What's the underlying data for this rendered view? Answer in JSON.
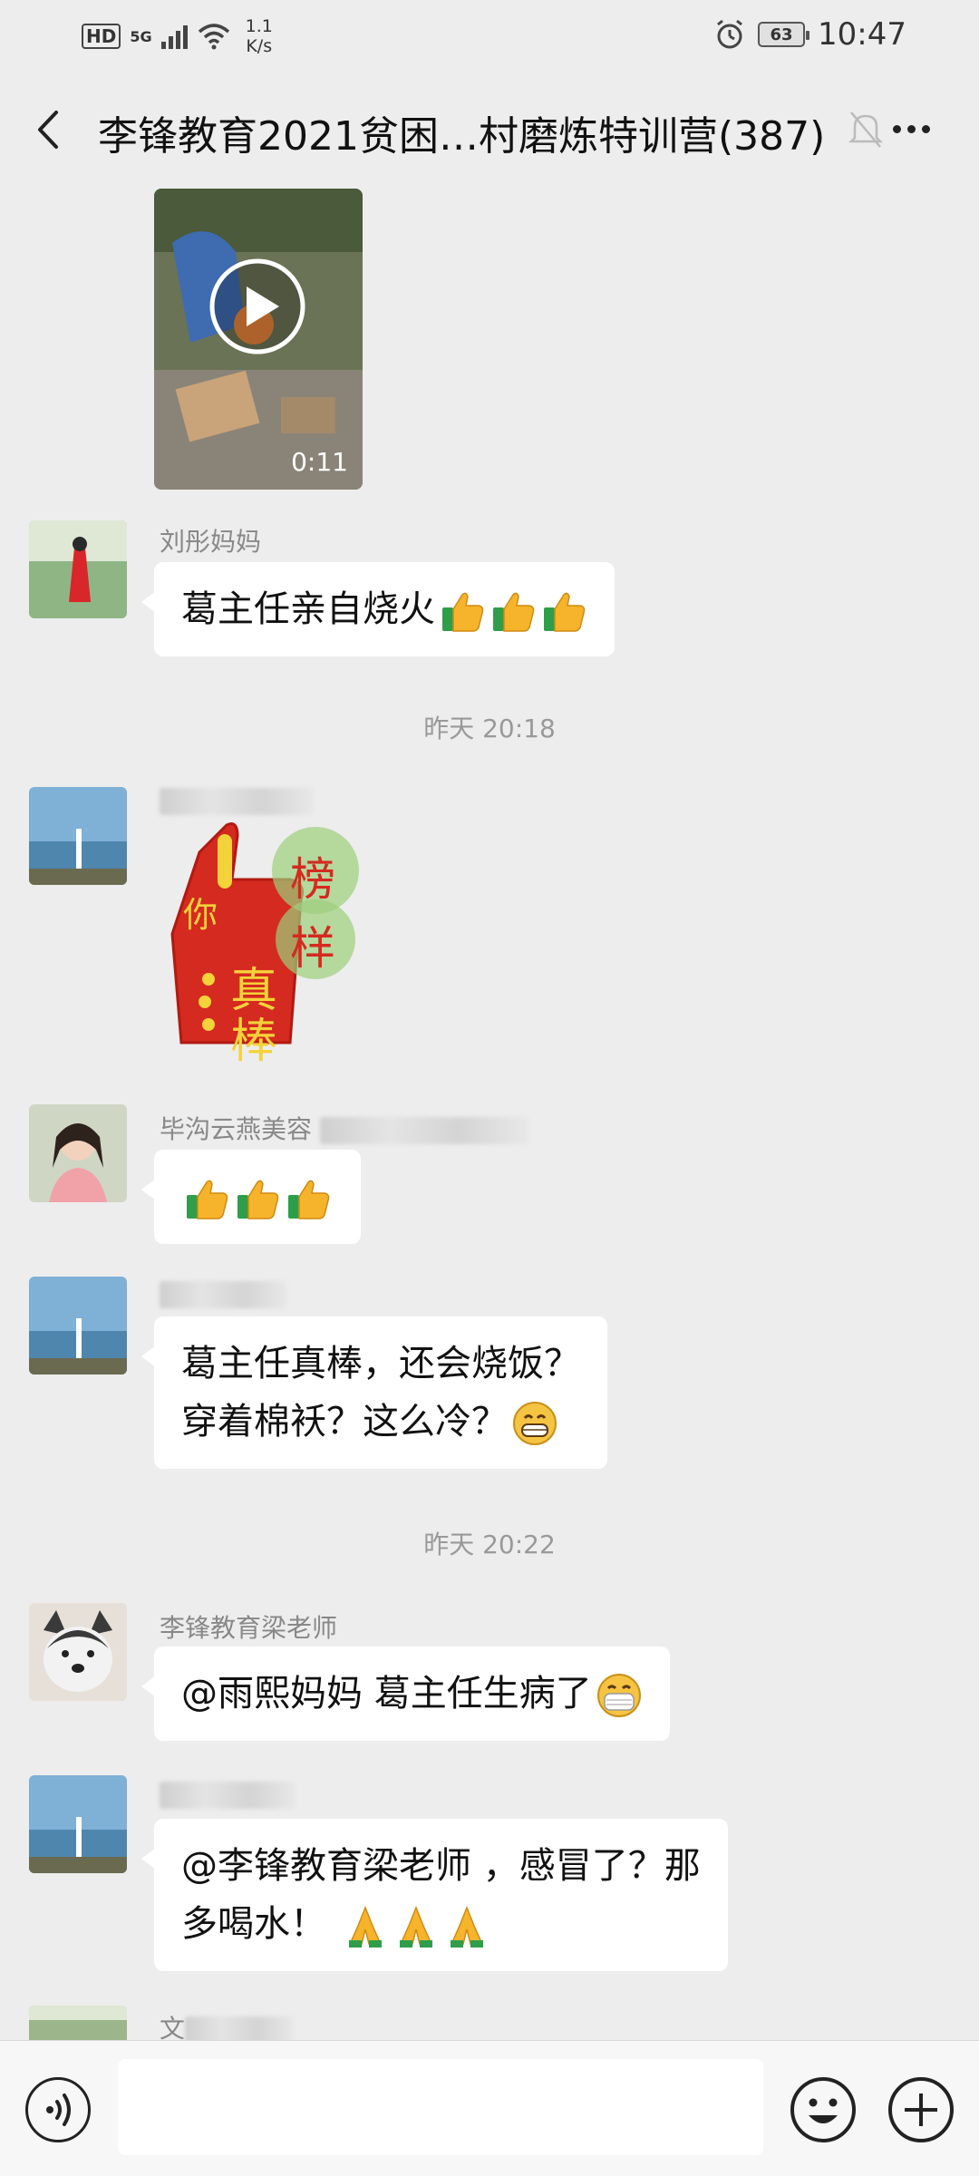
{
  "status_bar": {
    "hd": "HD",
    "network": "5G",
    "speed_top": "1.1",
    "speed_bottom": "K/s",
    "battery": "63",
    "time": "10:47"
  },
  "header": {
    "title": "李锋教育2021贫困…村磨炼特训营(387)"
  },
  "messages": {
    "video_duration": "0:11",
    "m1_sender": "刘彤妈妈",
    "m1_text": "葛主任亲自烧火",
    "ts1": "昨天 20:18",
    "m2_sender": "雨熙妈妈",
    "sticker_text": [
      "你",
      "真",
      "棒",
      "榜",
      "样"
    ],
    "m3_sender": "毕沟云燕美容",
    "m4_sender": "雨熙妈妈",
    "m4_line1": "葛主任真棒，还会烧饭？",
    "m4_line2": "穿着棉袄？这么冷？",
    "ts2": "昨天 20:22",
    "m5_sender": "李锋教育梁老师",
    "m5_text": "@雨熙妈妈  葛主任生病了",
    "m6_sender": "雨熙妈妈",
    "m6_line1": "@李锋教育梁老师 ，感冒了？那",
    "m6_line2": "多喝水！",
    "m7_sender": "文"
  },
  "icons": {
    "back": "back-icon",
    "mute": "mute-bell-icon",
    "more": "more-icon",
    "voice": "voice-icon",
    "emoji": "emoji-icon",
    "plus": "plus-icon"
  },
  "colors": {
    "background": "#ededed",
    "bubble": "#ffffff",
    "timestamp": "#999999",
    "sender": "#888888"
  }
}
